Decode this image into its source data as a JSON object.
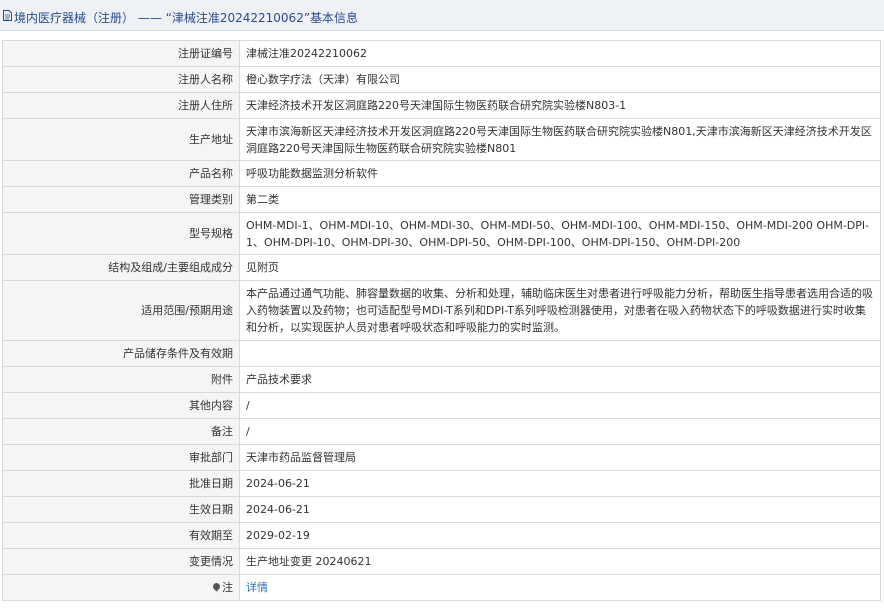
{
  "header": {
    "title": "境内医疗器械（注册） —— “津械注准20242210062”基本信息",
    "icon": "document-icon"
  },
  "rows": [
    {
      "label": "注册证编号",
      "value": "津械注准20242210062"
    },
    {
      "label": "注册人名称",
      "value": "橙心数字疗法（天津）有限公司"
    },
    {
      "label": "注册人住所",
      "value": "天津经济技术开发区洞庭路220号天津国际生物医药联合研究院实验楼N803-1"
    },
    {
      "label": "生产地址",
      "value": "天津市滨海新区天津经济技术开发区洞庭路220号天津国际生物医药联合研究院实验楼N801,天津市滨海新区天津经济技术开发区洞庭路220号天津国际生物医药联合研究院实验楼N801"
    },
    {
      "label": "产品名称",
      "value": "呼吸功能数据监测分析软件"
    },
    {
      "label": "管理类别",
      "value": "第二类"
    },
    {
      "label": "型号规格",
      "value": "OHM-MDI-1、OHM-MDI-10、OHM-MDI-30、OHM-MDI-50、OHM-MDI-100、OHM-MDI-150、OHM-MDI-200 OHM-DPI-1、OHM-DPI-10、OHM-DPI-30、OHM-DPI-50、OHM-DPI-100、OHM-DPI-150、OHM-DPI-200"
    },
    {
      "label": "结构及组成/主要组成成分",
      "value": "见附页"
    },
    {
      "label": "适用范围/预期用途",
      "value": "本产品通过通气功能、肺容量数据的收集、分析和处理，辅助临床医生对患者进行呼吸能力分析，帮助医生指导患者选用合适的吸入药物装置以及药物；也可适配型号MDI-T系列和DPI-T系列呼吸检测器使用，对患者在吸入药物状态下的呼吸数据进行实时收集和分析，以实现医护人员对患者呼吸状态和呼吸能力的实时监测。"
    },
    {
      "label": "产品储存条件及有效期",
      "value": ""
    },
    {
      "label": "附件",
      "value": "产品技术要求"
    },
    {
      "label": "其他内容",
      "value": "/"
    },
    {
      "label": "备注",
      "value": "/"
    },
    {
      "label": "审批部门",
      "value": "天津市药品监督管理局"
    },
    {
      "label": "批准日期",
      "value": "2024-06-21"
    },
    {
      "label": "生效日期",
      "value": "2024-06-21"
    },
    {
      "label": "有效期至",
      "value": "2029-02-19"
    },
    {
      "label": "变更情况",
      "value": "生产地址变更 20240621"
    }
  ],
  "note_row": {
    "label": "注",
    "link_text": "详情",
    "icon": "location-pin-icon"
  }
}
